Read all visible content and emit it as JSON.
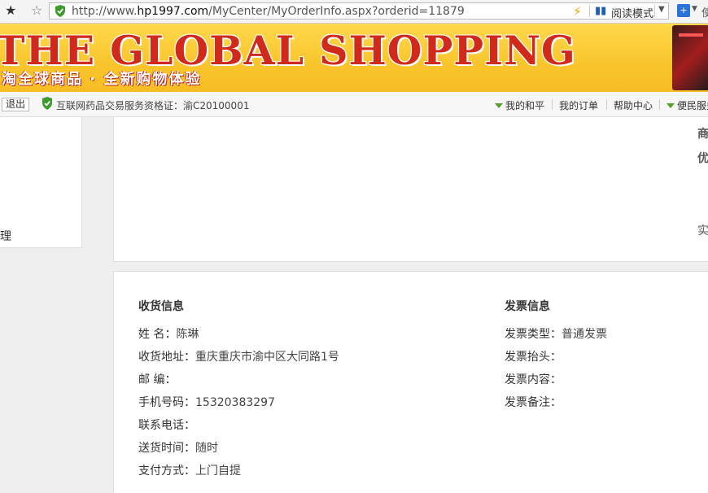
{
  "browser": {
    "url_prefix": "http://www.",
    "url_domain": "hp1997.com",
    "url_path": "/MyCenter/MyOrderInfo.aspx?orderid=11879",
    "reader_mode": "阅读模式",
    "trailing_glyph": "使"
  },
  "banner": {
    "title": "THE GLOBAL SHOPPING",
    "slogan": "淘全球商品 · 全新购物体验"
  },
  "topnav": {
    "logout": "退出",
    "license": "互联网药品交易服务资格证：渝C20100001",
    "my_heping": "我的和平",
    "my_orders": "我的订单",
    "help": "帮助中心",
    "convenience": "便民服务"
  },
  "sidebar": {
    "fragment": "理"
  },
  "summary_fragments": {
    "line1": "商",
    "line2": "优",
    "line3": "实"
  },
  "shipping": {
    "title": "收货信息",
    "rows": [
      {
        "label": "姓  名：",
        "value": "陈琳"
      },
      {
        "label": "收货地址：",
        "value": "重庆重庆市渝中区大同路1号"
      },
      {
        "label": "邮  编：",
        "value": ""
      },
      {
        "label": "手机号码：",
        "value": "15320383297"
      },
      {
        "label": "联系电话：",
        "value": ""
      },
      {
        "label": "送货时间：",
        "value": "随时"
      },
      {
        "label": "支付方式：",
        "value": "上门自提"
      }
    ]
  },
  "invoice": {
    "title": "发票信息",
    "rows": [
      {
        "label": "发票类型：",
        "value": "普通发票"
      },
      {
        "label": "发票抬头：",
        "value": ""
      },
      {
        "label": "发票内容：",
        "value": ""
      },
      {
        "label": "发票备注：",
        "value": ""
      }
    ]
  },
  "colors": {
    "accent_green": "#5a9e2a",
    "banner_red": "#cf2a1c",
    "banner_yellow": "#f9c52c"
  }
}
